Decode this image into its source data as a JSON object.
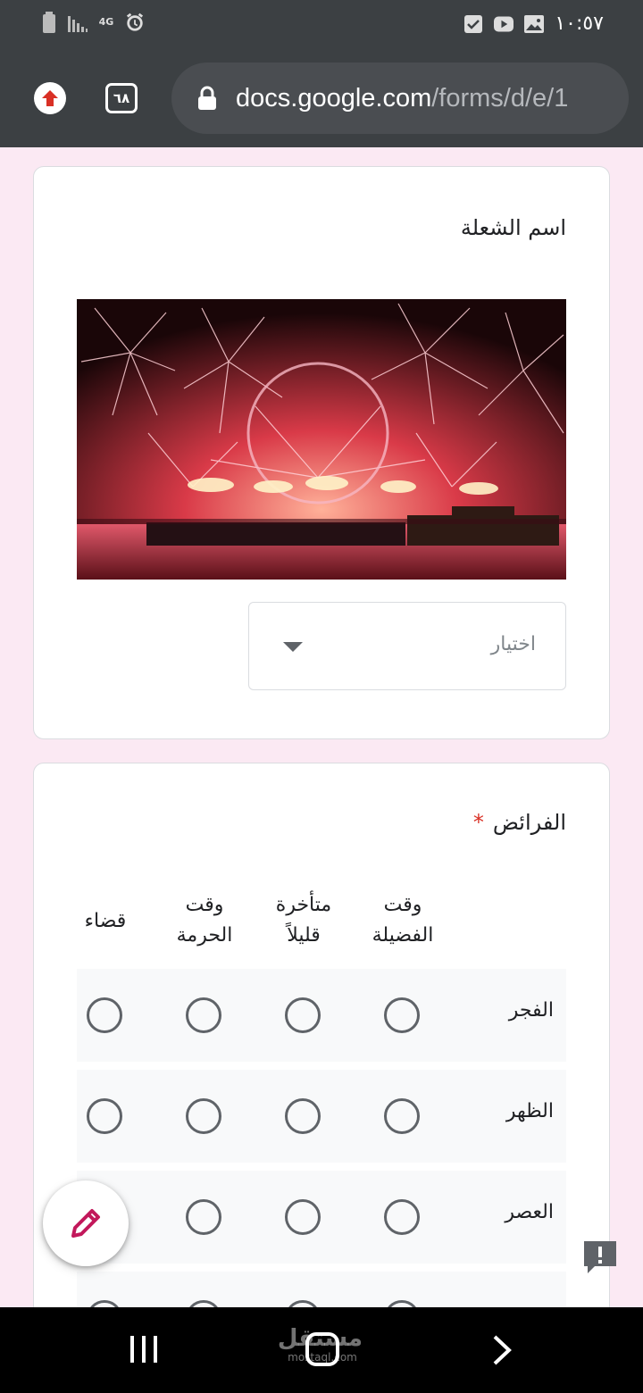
{
  "status_bar": {
    "time": "١٠:٥٧",
    "network_label": "4G",
    "icons_left": [
      "battery-icon",
      "signal-icon",
      "network-4g-icon",
      "alarm-icon"
    ],
    "icons_right": [
      "checkbox-notification-icon",
      "youtube-icon",
      "gallery-icon"
    ]
  },
  "browser": {
    "tab_count": "٦٨",
    "url_domain": "docs.google.com",
    "url_path": "/forms/d/e/1"
  },
  "form": {
    "question1": {
      "title": "اسم الشعلة",
      "image": "fireworks-photo",
      "dropdown_placeholder": "اختيار"
    },
    "question2": {
      "title": "الفرائض",
      "required_mark": "*",
      "columns": [
        {
          "line1": "وقت",
          "line2": "الفضيلة"
        },
        {
          "line1": "متأخرة",
          "line2": "قليلاً"
        },
        {
          "line1": "وقت",
          "line2": "الحرمة"
        },
        {
          "line1": "قضاء",
          "line2": ""
        }
      ],
      "rows": [
        {
          "label": "الفجر"
        },
        {
          "label": "الظهر"
        },
        {
          "label": "العصر"
        },
        {
          "label": ""
        }
      ]
    }
  },
  "fab": {
    "icon": "pencil-icon",
    "color": "#c2185b"
  },
  "feedback": {
    "icon": "feedback-icon",
    "color": "#5f6368"
  },
  "nav_bar": {
    "watermark_main": "مستقل",
    "watermark_sub": "mostaql.com"
  }
}
